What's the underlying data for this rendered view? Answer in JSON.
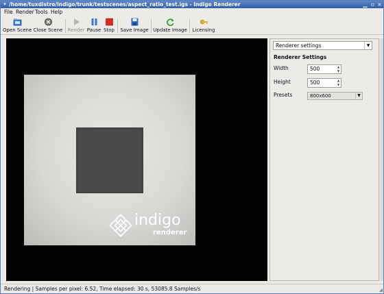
{
  "window": {
    "title": "/home/tuxdistro/indigo/trunk/testscenes/aspect_ratio_test.igs - Indigo Renderer"
  },
  "menubar": {
    "items": [
      "File",
      "Render",
      "Tools",
      "Help"
    ]
  },
  "toolbar": {
    "open_scene": "Open Scene",
    "close_scene": "Close Scene",
    "render": "Render",
    "pause": "Pause",
    "stop": "Stop",
    "save_image": "Save Image",
    "update_image": "Update Image",
    "licensing": "Licensing"
  },
  "render_view": {
    "logo_text": "indigo",
    "logo_subtext": "renderer"
  },
  "side_panel": {
    "dropdown_value": "Renderer settings",
    "heading": "Renderer Settings",
    "width_label": "Width",
    "width_value": "500",
    "height_label": "Height",
    "height_value": "500",
    "presets_label": "Presets",
    "presets_value": "800x600"
  },
  "statusbar": {
    "text": "Rendering | Samples per pixel: 6.52, Time elapsed: 30 s, 53085.8 Samples/s"
  },
  "icons": {
    "open_scene": "open-folder-icon",
    "close_scene": "close-circle-icon",
    "render": "play-icon",
    "pause": "pause-icon",
    "stop": "stop-icon",
    "save_image": "floppy-disk-icon",
    "update_image": "refresh-icon",
    "licensing": "key-icon"
  },
  "colors": {
    "titlebar": "#2f5ea8",
    "pause_icon": "#3f76c8",
    "stop_icon": "#d42b1e",
    "update_icon": "#3aa336",
    "licensing_icon": "#e3b127"
  }
}
